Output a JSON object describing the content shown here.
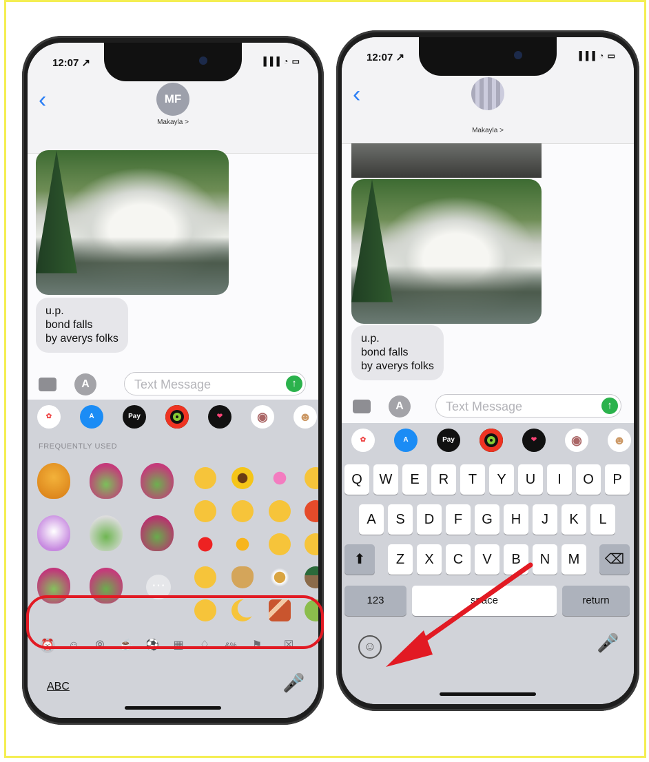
{
  "left": {
    "status_time": "12:07 ↗",
    "status_icons": "▐▐▐ ◔ ▭",
    "avatar_initials": "MF",
    "contact_name": "Makayla >",
    "message_text": "u.p.\nbond falls\nby averys folks",
    "text_placeholder": "Text Message",
    "section_label": "FREQUENTLY USED",
    "categories": [
      "⏰",
      "☺",
      "⦾",
      "☕",
      "⚽",
      "▦",
      "♢",
      "&%",
      "⚑",
      "☒"
    ],
    "abc_label": "ABC"
  },
  "right": {
    "status_time": "12:07 ↗",
    "status_icons": "▐▐▐ ◔ ▭",
    "contact_name": "Makayla >",
    "message_text": "u.p.\nbond falls\nby averys folks",
    "text_placeholder": "Text Message",
    "row1": [
      "Q",
      "W",
      "E",
      "R",
      "T",
      "Y",
      "U",
      "I",
      "O",
      "P"
    ],
    "row2": [
      "A",
      "S",
      "D",
      "F",
      "G",
      "H",
      "J",
      "K",
      "L"
    ],
    "row3": [
      "Z",
      "X",
      "C",
      "V",
      "B",
      "N",
      "M"
    ],
    "key_123": "123",
    "key_space": "space",
    "key_return": "return"
  },
  "app_icons": [
    "Photos",
    "App Store",
    "Apple Pay",
    "Activity",
    "Digital Touch",
    "Animoji",
    "Memoji"
  ],
  "colors": {
    "accent": "#2a7ef5",
    "highlight": "#e21a23",
    "send": "#2bb24c"
  }
}
